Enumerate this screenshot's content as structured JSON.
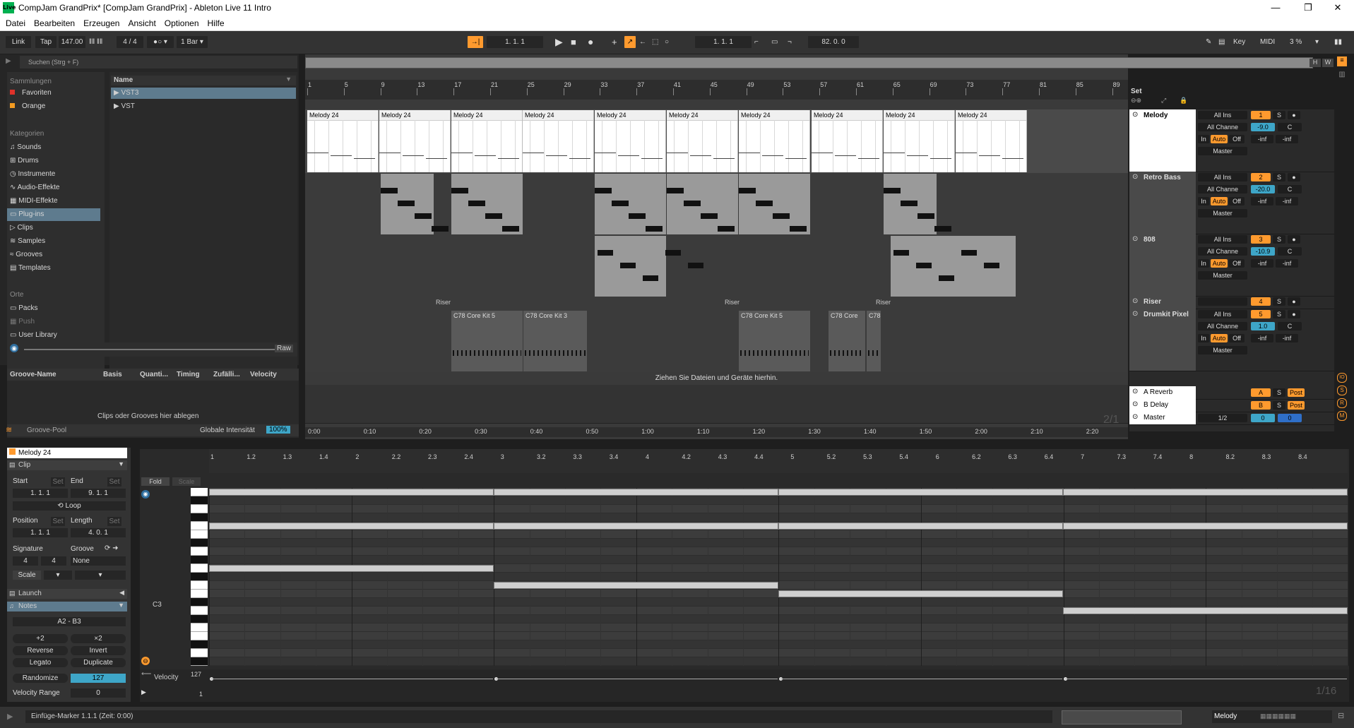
{
  "window": {
    "title": "CompJam GrandPrix*  [CompJam GrandPrix] - Ableton Live 11 Intro",
    "logo_text": "Live",
    "controls": [
      "—",
      "❐",
      "✕"
    ]
  },
  "menu": [
    "Datei",
    "Bearbeiten",
    "Erzeugen",
    "Ansicht",
    "Optionen",
    "Hilfe"
  ],
  "transport": {
    "link": "Link",
    "tap": "Tap",
    "tempo": "147.00",
    "signature": "4 / 4",
    "metronome_rate": "1 Bar",
    "arrangement_pos": "1.   1.   1",
    "loop_start": "1.   1.   1",
    "loop_length": "82.   0.   0",
    "key": "Key",
    "midi": "MIDI",
    "cpu": "3 %"
  },
  "browser": {
    "search_placeholder": "Suchen (Strg + F)",
    "collections_header": "Sammlungen",
    "collections": [
      {
        "label": "Favoriten",
        "color": "#e0322a"
      },
      {
        "label": "Orange",
        "color": "#f39b21"
      }
    ],
    "categories_header": "Kategorien",
    "categories": [
      "Sounds",
      "Drums",
      "Instrumente",
      "Audio-Effekte",
      "MIDI-Effekte",
      "Plug-ins",
      "Clips",
      "Samples",
      "Grooves",
      "Templates"
    ],
    "places_header": "Orte",
    "places": [
      "Packs",
      "Push",
      "User Library"
    ],
    "name_column": "Name",
    "items": [
      "VST3",
      "VST"
    ],
    "raw": "Raw",
    "groove_columns": [
      "Groove-Name",
      "Basis",
      "Quanti...",
      "Timing",
      "Zufälli...",
      "Velocity"
    ],
    "groove_drop": "Clips oder Grooves hier ablegen",
    "groove_pool": "Groove-Pool",
    "global_intensity_label": "Globale Intensität",
    "global_intensity_value": "100%"
  },
  "arrangement": {
    "bars": [
      "1",
      "5",
      "9",
      "13",
      "17",
      "21",
      "25",
      "29",
      "33",
      "37",
      "41",
      "45",
      "49",
      "53",
      "57",
      "61",
      "65",
      "69",
      "73",
      "77",
      "81",
      "85",
      "89"
    ],
    "times": [
      "0:00",
      "0:10",
      "0:20",
      "0:30",
      "0:40",
      "0:50",
      "1:00",
      "1:10",
      "1:20",
      "1:30",
      "1:40",
      "1:50",
      "2:00",
      "2:10",
      "2:20"
    ],
    "melody_clip_name": "Melody 24",
    "riser_label": "Riser",
    "drum_clips": [
      "C78 Core Kit 5",
      "C78 Core Kit 3",
      "C78 Core Kit 5",
      "C78 Core",
      "C78"
    ],
    "drop_hint": "Ziehen Sie Dateien und Geräte hierhin.",
    "zoom": "2/1",
    "set_label": "Set",
    "hw": [
      "H",
      "W"
    ]
  },
  "tracks": [
    {
      "name": "Melody",
      "input": "All Ins",
      "channel": "All Channe",
      "output": "Master",
      "num": "1",
      "vol": "-9.0",
      "pan": "C",
      "meter": [
        "-inf",
        "-inf"
      ]
    },
    {
      "name": "Retro Bass",
      "input": "All Ins",
      "channel": "All Channe",
      "output": "Master",
      "num": "2",
      "vol": "-20.0",
      "pan": "C",
      "meter": [
        "-inf",
        "-inf"
      ]
    },
    {
      "name": "808",
      "input": "All Ins",
      "channel": "All Channe",
      "output": "Master",
      "num": "3",
      "vol": "-10.9",
      "pan": "C",
      "meter": [
        "-inf",
        "-inf"
      ]
    },
    {
      "name": "Riser",
      "num": "4"
    },
    {
      "name": "Drumkit Pixel",
      "input": "All Ins",
      "channel": "All Channe",
      "output": "Master",
      "num": "5",
      "vol": "1.0",
      "pan": "C",
      "meter": [
        "-inf",
        "-inf"
      ]
    }
  ],
  "returns": [
    {
      "name": "A Reverb",
      "letter": "A",
      "post": "Post"
    },
    {
      "name": "B Delay",
      "letter": "B",
      "post": "Post"
    }
  ],
  "master": {
    "name": "Master",
    "cue": "1/2",
    "vol": "0",
    "pan": "0"
  },
  "monitor": {
    "in": "In",
    "auto": "Auto",
    "off": "Off",
    "solo": "S"
  },
  "clip": {
    "name": "Melody 24",
    "section": "Clip",
    "start_label": "Start",
    "end_label": "End",
    "set": "Set",
    "start": "1.   1.   1",
    "end": "9.   1.   1",
    "loop": "Loop",
    "position_label": "Position",
    "length_label": "Length",
    "position": "1.   1.   1",
    "length": "4.   0.   1",
    "signature_label": "Signature",
    "groove_label": "Groove",
    "sig_num": "4",
    "sig_den": "4",
    "groove": "None",
    "scale": "Scale",
    "launch": "Launch",
    "notes": "Notes",
    "range": "A2 - B3",
    "plus2": "+2",
    "times2": "×2",
    "reverse": "Reverse",
    "invert": "Invert",
    "legato": "Legato",
    "duplicate": "Duplicate",
    "randomize": "Randomize",
    "randomize_value": "127",
    "velocity_range_label": "Velocity Range",
    "velocity_range": "0"
  },
  "editor": {
    "fold": "Fold",
    "scale": "Scale",
    "ruler": [
      "1",
      "1.2",
      "1.3",
      "1.4",
      "2",
      "2.2",
      "2.3",
      "2.4",
      "3",
      "3.2",
      "3.3",
      "3.4",
      "4",
      "4.2",
      "4.3",
      "4.4",
      "5",
      "5.2",
      "5.3",
      "5.4",
      "6",
      "6.2",
      "6.3",
      "6.4",
      "7",
      "7.3",
      "7.4",
      "8",
      "8.2",
      "8.3",
      "8.4"
    ],
    "c3": "C3",
    "velocity_label": "Velocity",
    "vel_max": "127",
    "vel_min": "1",
    "grid": "1/16"
  },
  "status": {
    "message": "Einfüge-Marker 1.1.1 (Zeit: 0:00)",
    "track": "Melody"
  }
}
